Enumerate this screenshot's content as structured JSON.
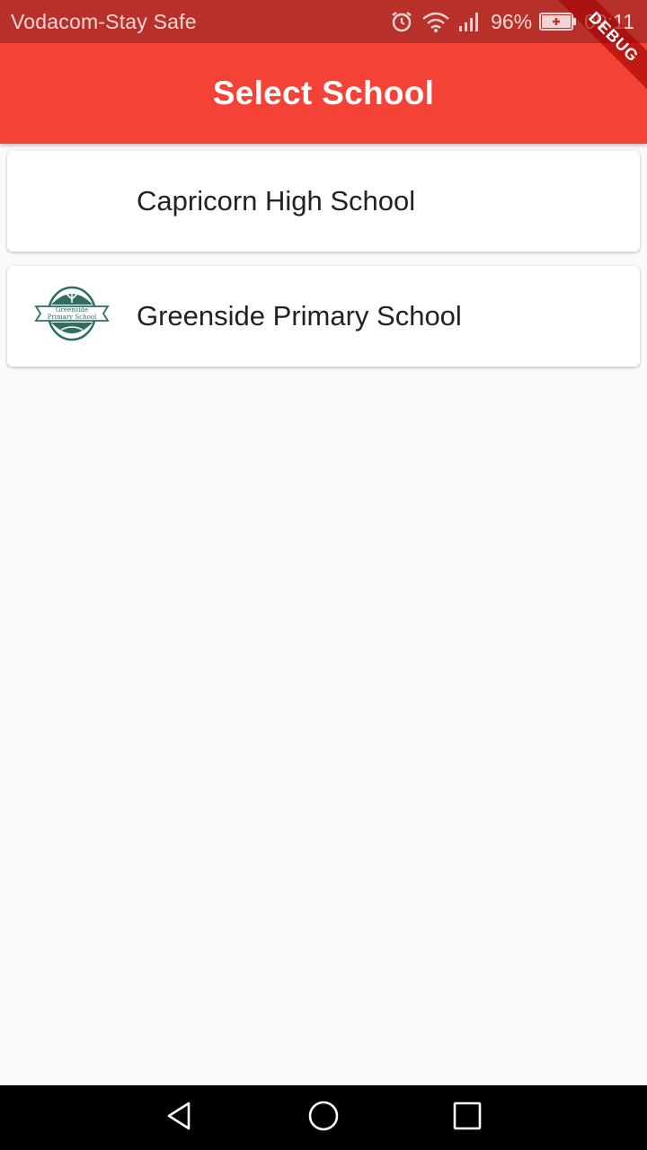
{
  "status_bar": {
    "carrier": "Vodacom-Stay Safe",
    "battery_percent": "96%",
    "time": "09:11",
    "icons": [
      "alarm-icon",
      "wifi-icon",
      "signal-icon",
      "battery-icon"
    ]
  },
  "app_bar": {
    "title": "Select School",
    "color": "#f44336"
  },
  "debug_banner": "DEBUG",
  "schools": [
    {
      "name": "Capricorn High School",
      "has_logo": false
    },
    {
      "name": "Greenside Primary School",
      "has_logo": true,
      "logo_text_line1": "Greenside",
      "logo_text_line2": "Primary School"
    }
  ],
  "nav": {
    "icons": [
      "back-icon",
      "home-icon",
      "recents-icon"
    ]
  }
}
